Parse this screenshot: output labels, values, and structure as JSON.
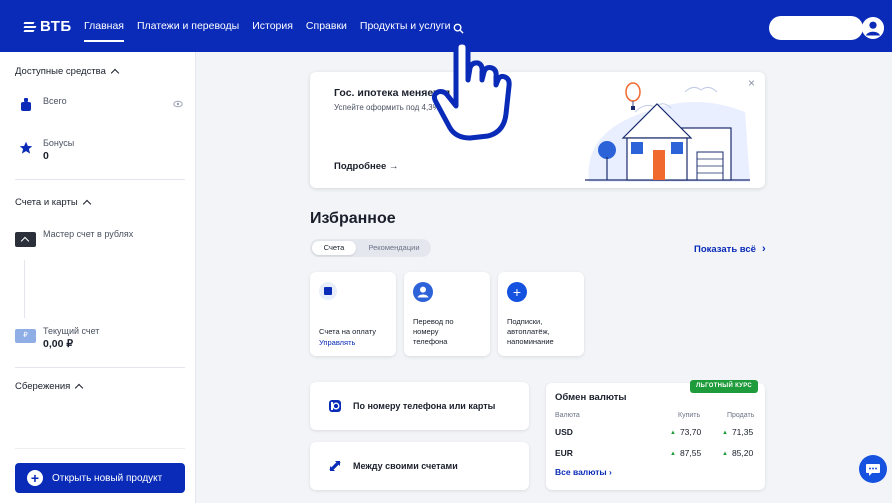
{
  "header": {
    "logo": "ВТБ",
    "nav": [
      "Главная",
      "Платежи и переводы",
      "История",
      "Справки",
      "Продукты и услуги"
    ],
    "active_nav": "Главная",
    "search_icon": "search-icon",
    "brand_color": "#0a2bb8"
  },
  "sidebar": {
    "available_title": "Доступные средства",
    "total_label": "Всего",
    "bonus_label": "Бонусы",
    "bonus_value": "0",
    "accounts_title": "Счета и карты",
    "master_account": "Мастер счет в рублях",
    "current_account_label": "Текущий счет",
    "current_account_value": "0,00 ₽",
    "savings_title": "Сбережения",
    "open_product": "Открыть новый продукт"
  },
  "banner": {
    "title": "Гос. ипотека меняется",
    "subtitle": "Успейте оформить под 4,3%",
    "more": "Подробнее",
    "close": "×"
  },
  "favorites": {
    "title": "Избранное",
    "tabs": [
      "Счета",
      "Рекомендации"
    ],
    "active_tab": "Счета",
    "show_all": "Показать всё",
    "tiles": [
      {
        "label": "Счета на оплату",
        "link": "Управлять",
        "icon": "invoice-icon"
      },
      {
        "label": "Перевод по номеру телефона",
        "icon": "person-icon"
      },
      {
        "label": "Подписки, автоплатёж, напоминание",
        "icon": "plus-icon"
      }
    ]
  },
  "transfers": [
    {
      "label": "По номеру телефона или карты",
      "icon": "phone-transfer-icon"
    },
    {
      "label": "Между своими счетами",
      "icon": "swap-arrows-icon"
    }
  ],
  "currency": {
    "title": "Обмен валюты",
    "badge": "ЛЬГОТНЫЙ КУРС",
    "col_currency": "Валюта",
    "col_buy": "Купить",
    "col_sell": "Продать",
    "rows": [
      {
        "code": "USD",
        "buy": "73,70",
        "sell": "71,35"
      },
      {
        "code": "EUR",
        "buy": "87,55",
        "sell": "85,20"
      }
    ],
    "all_link": "Все валюты",
    "up_color": "#1e9b3a"
  }
}
